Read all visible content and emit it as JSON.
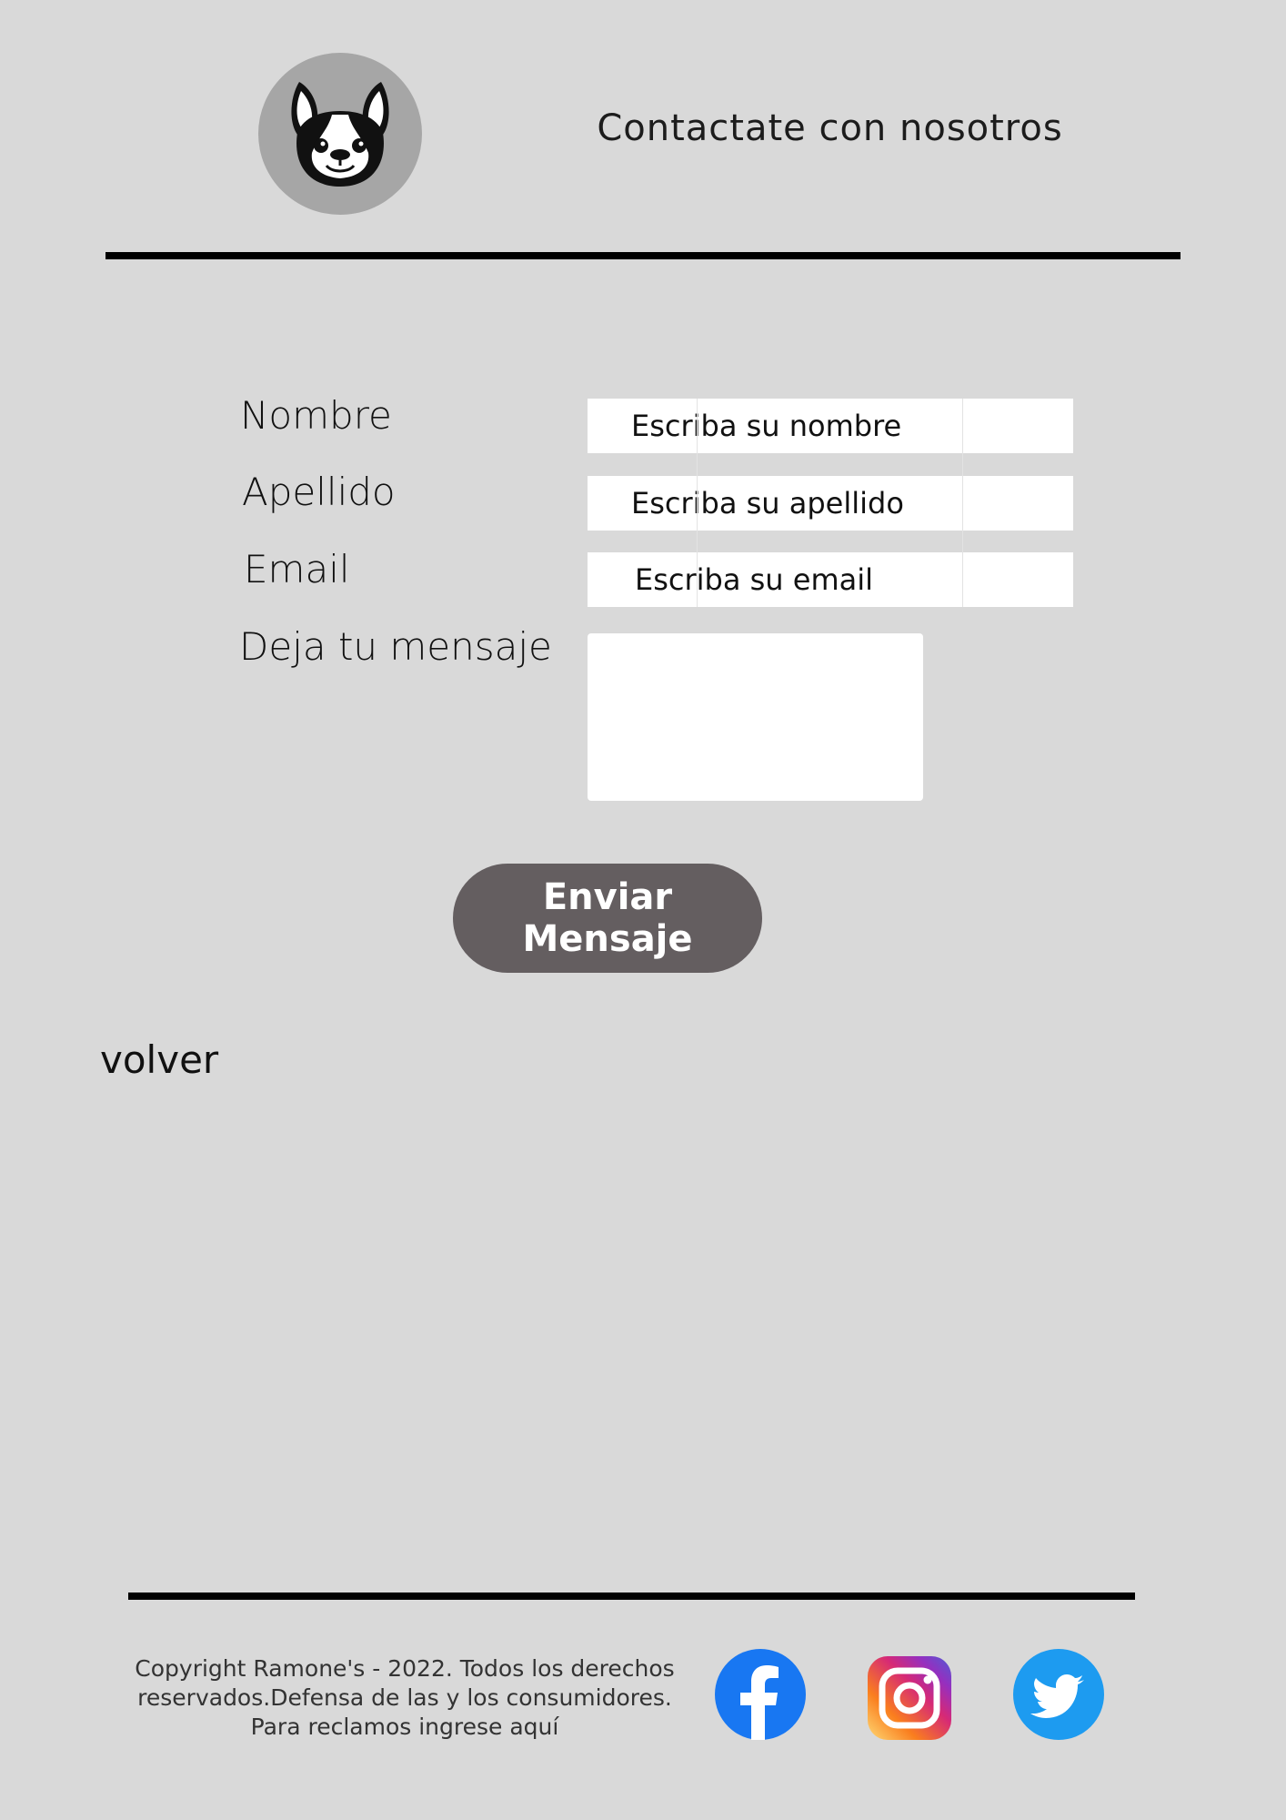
{
  "header": {
    "title": "Contactate con nosotros",
    "logo_icon": "french-bulldog-icon"
  },
  "form": {
    "nombre_label": "Nombre",
    "nombre_placeholder": "Escriba su nombre",
    "apellido_label": "Apellido",
    "apellido_placeholder": "Escriba su apellido",
    "email_label": "Email",
    "email_placeholder": "Escriba su email",
    "mensaje_label": "Deja tu mensaje",
    "mensaje_value": "",
    "submit_label": "Enviar Mensaje"
  },
  "back_link": "volver",
  "footer": {
    "copyright_line1": "Copyright Ramone's - 2022. Todos los derechos",
    "copyright_line2": "reservados.Defensa de las y los consumidores.",
    "copyright_line3": "Para reclamos ingrese aquí",
    "social": [
      "facebook-icon",
      "instagram-icon",
      "twitter-icon"
    ]
  },
  "colors": {
    "background": "#d9d9d9",
    "logo_circle": "#a6a6a6",
    "button": "#645e60",
    "facebook": "#1877f2",
    "twitter": "#1d9bf0"
  }
}
